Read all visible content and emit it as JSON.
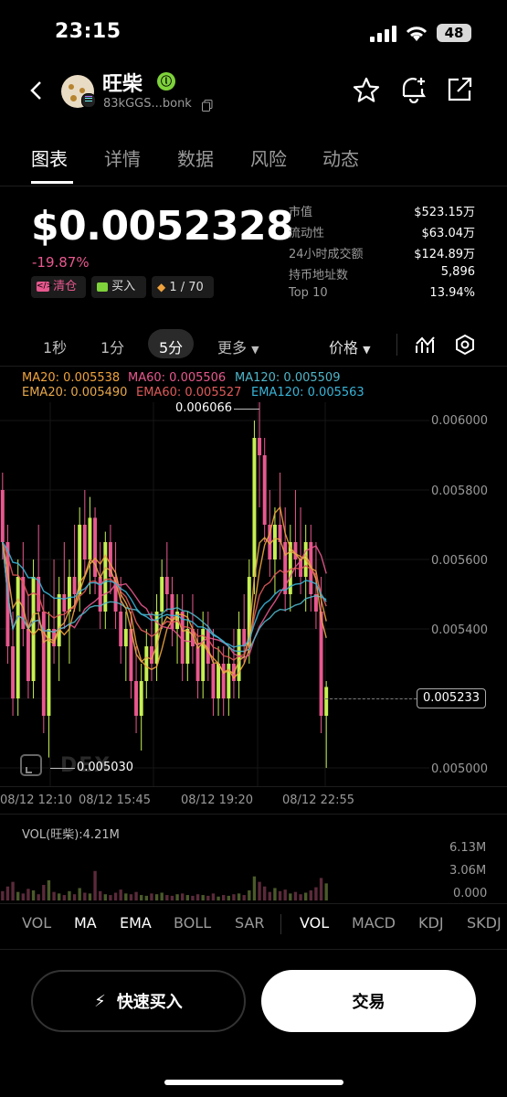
{
  "status_bar": {
    "time": "23:15",
    "battery": "48"
  },
  "header": {
    "token_name": "旺柴",
    "address": "83kGGS...bonk"
  },
  "tabs": [
    "图表",
    "详情",
    "数据",
    "风险",
    "动态"
  ],
  "price_block": {
    "price": "$0.0052328",
    "change": "-19.87%",
    "badges": {
      "clear": "清仓",
      "buy": "买入",
      "ratio": "1 / 70"
    }
  },
  "stats": [
    {
      "label": "市值",
      "value": "$523.15万"
    },
    {
      "label": "流动性",
      "value": "$63.04万"
    },
    {
      "label": "24小时成交额",
      "value": "$124.89万"
    },
    {
      "label": "持币地址数",
      "value": "5,896"
    },
    {
      "label": "Top 10",
      "value": "13.94%"
    }
  ],
  "timeframes": {
    "t1": "1秒",
    "t2": "1分",
    "t3": "5分",
    "more": "更多",
    "price": "价格"
  },
  "indicators": {
    "ma20": "MA20: 0.005538",
    "ma60": "MA60: 0.005506",
    "ma120": "MA120: 0.005509",
    "ema20": "EMA20: 0.005490",
    "ema60": "EMA60: 0.005527",
    "ema120": "EMA120: 0.005563"
  },
  "colors": {
    "ma20": "#f0a33c",
    "ma60": "#e8588e",
    "ma120": "#4fb6c9",
    "ema20": "#e8a84a",
    "ema60": "#e05a5a",
    "ema120": "#38b4d8",
    "up": "#c6f052",
    "down": "#e8588e"
  },
  "chart_data": {
    "type": "candlestick",
    "y_ticks": [
      "0.006000",
      "0.005800",
      "0.005600",
      "0.005400",
      "0.005000"
    ],
    "x_ticks": [
      "08/12 12:10",
      "08/12 15:45",
      "08/12 19:20",
      "08/12 22:55"
    ],
    "ylim": [
      0.00495,
      0.00606
    ],
    "high_label": "0.006066",
    "low_label": "0.005030",
    "current_price": "0.005233",
    "watermark": "DEX",
    "candles": [
      [
        0.0058,
        0.00585,
        0.0056,
        0.00565
      ],
      [
        0.00565,
        0.0057,
        0.0053,
        0.00535
      ],
      [
        0.00535,
        0.00545,
        0.00515,
        0.0052
      ],
      [
        0.0052,
        0.0056,
        0.00515,
        0.00555
      ],
      [
        0.00555,
        0.00565,
        0.00535,
        0.0054
      ],
      [
        0.0054,
        0.0055,
        0.0052,
        0.00525
      ],
      [
        0.00525,
        0.0056,
        0.0052,
        0.00555
      ],
      [
        0.00555,
        0.0057,
        0.0054,
        0.00545
      ],
      [
        0.00545,
        0.0055,
        0.0051,
        0.00515
      ],
      [
        0.00515,
        0.00545,
        0.00503,
        0.0054
      ],
      [
        0.0054,
        0.0056,
        0.0053,
        0.00535
      ],
      [
        0.00535,
        0.00555,
        0.00525,
        0.0055
      ],
      [
        0.0055,
        0.00565,
        0.0054,
        0.00545
      ],
      [
        0.00545,
        0.0056,
        0.0053,
        0.00555
      ],
      [
        0.00555,
        0.0057,
        0.00545,
        0.0055
      ],
      [
        0.0055,
        0.00575,
        0.00545,
        0.0057
      ],
      [
        0.0057,
        0.0058,
        0.00555,
        0.0056
      ],
      [
        0.0056,
        0.00578,
        0.0055,
        0.00572
      ],
      [
        0.00572,
        0.00575,
        0.0055,
        0.00555
      ],
      [
        0.00555,
        0.00565,
        0.0054,
        0.00545
      ],
      [
        0.00545,
        0.00568,
        0.0054,
        0.00565
      ],
      [
        0.00565,
        0.0057,
        0.0055,
        0.00555
      ],
      [
        0.00555,
        0.00565,
        0.0054,
        0.00545
      ],
      [
        0.00545,
        0.00555,
        0.0053,
        0.00535
      ],
      [
        0.00535,
        0.00545,
        0.00525,
        0.0054
      ],
      [
        0.0054,
        0.00545,
        0.0052,
        0.00525
      ],
      [
        0.00525,
        0.00535,
        0.0051,
        0.00515
      ],
      [
        0.00515,
        0.0053,
        0.00505,
        0.00525
      ],
      [
        0.00525,
        0.0054,
        0.0052,
        0.00535
      ],
      [
        0.00535,
        0.00545,
        0.00525,
        0.0053
      ],
      [
        0.0053,
        0.0055,
        0.00525,
        0.00545
      ],
      [
        0.00545,
        0.0056,
        0.0054,
        0.00555
      ],
      [
        0.00555,
        0.00565,
        0.00545,
        0.0055
      ],
      [
        0.0055,
        0.00555,
        0.00535,
        0.0054
      ],
      [
        0.0054,
        0.0055,
        0.0053,
        0.00545
      ],
      [
        0.00545,
        0.0055,
        0.00525,
        0.0053
      ],
      [
        0.0053,
        0.00545,
        0.00525,
        0.0054
      ],
      [
        0.0054,
        0.0055,
        0.0053,
        0.00535
      ],
      [
        0.00535,
        0.0054,
        0.0052,
        0.00525
      ],
      [
        0.00525,
        0.00545,
        0.0052,
        0.0054
      ],
      [
        0.0054,
        0.00545,
        0.00525,
        0.0053
      ],
      [
        0.0053,
        0.0054,
        0.00515,
        0.0052
      ],
      [
        0.0052,
        0.00535,
        0.00515,
        0.0053
      ],
      [
        0.0053,
        0.00535,
        0.00515,
        0.0052
      ],
      [
        0.0052,
        0.00535,
        0.00515,
        0.0053
      ],
      [
        0.0053,
        0.0054,
        0.0052,
        0.00525
      ],
      [
        0.00525,
        0.00545,
        0.0052,
        0.0054
      ],
      [
        0.0054,
        0.0055,
        0.0053,
        0.00535
      ],
      [
        0.00535,
        0.0056,
        0.0053,
        0.00555
      ],
      [
        0.00555,
        0.006,
        0.0055,
        0.00595
      ],
      [
        0.00595,
        0.006066,
        0.00575,
        0.0059
      ],
      [
        0.0059,
        0.00595,
        0.00565,
        0.0057
      ],
      [
        0.0057,
        0.0058,
        0.00555,
        0.0056
      ],
      [
        0.0056,
        0.00575,
        0.0055,
        0.0057
      ],
      [
        0.0057,
        0.00585,
        0.0056,
        0.00565
      ],
      [
        0.00565,
        0.00575,
        0.00545,
        0.0055
      ],
      [
        0.0055,
        0.0057,
        0.00545,
        0.00565
      ],
      [
        0.00565,
        0.0058,
        0.00555,
        0.0056
      ],
      [
        0.0056,
        0.00575,
        0.0055,
        0.00555
      ],
      [
        0.00555,
        0.0057,
        0.00545,
        0.00565
      ],
      [
        0.00565,
        0.0057,
        0.00545,
        0.0055
      ],
      [
        0.0055,
        0.00565,
        0.0054,
        0.00545
      ],
      [
        0.00545,
        0.00555,
        0.0051,
        0.00515
      ],
      [
        0.00515,
        0.00525,
        0.005,
        0.005233
      ]
    ],
    "volume_label": "VOL(旺柴):4.21M",
    "volume_ticks": [
      "6.13M",
      "3.06M",
      "0.000"
    ],
    "volume_max": 6.13,
    "volumes": [
      1.2,
      1.8,
      2.4,
      1.1,
      0.9,
      1.5,
      1.3,
      0.8,
      2.0,
      2.6,
      1.1,
      0.9,
      0.7,
      1.2,
      0.8,
      1.6,
      1.0,
      0.9,
      3.8,
      1.2,
      0.8,
      0.7,
      1.0,
      1.4,
      0.9,
      0.8,
      1.1,
      0.7,
      0.6,
      0.9,
      0.8,
      1.0,
      0.7,
      0.6,
      0.8,
      0.9,
      0.7,
      0.6,
      0.8,
      0.7,
      0.6,
      0.9,
      0.5,
      0.7,
      0.6,
      0.8,
      0.9,
      0.7,
      1.3,
      3.1,
      2.4,
      1.8,
      1.1,
      1.6,
      1.2,
      1.4,
      0.9,
      1.1,
      0.8,
      1.0,
      1.3,
      1.7,
      2.9,
      2.2
    ]
  },
  "bottom_tabs": {
    "left": [
      "VOL",
      "MA",
      "EMA",
      "BOLL",
      "SAR"
    ],
    "right": [
      "VOL",
      "MACD",
      "KDJ",
      "SKDJ"
    ]
  },
  "buttons": {
    "quick_buy": "快速买入",
    "trade": "交易"
  }
}
